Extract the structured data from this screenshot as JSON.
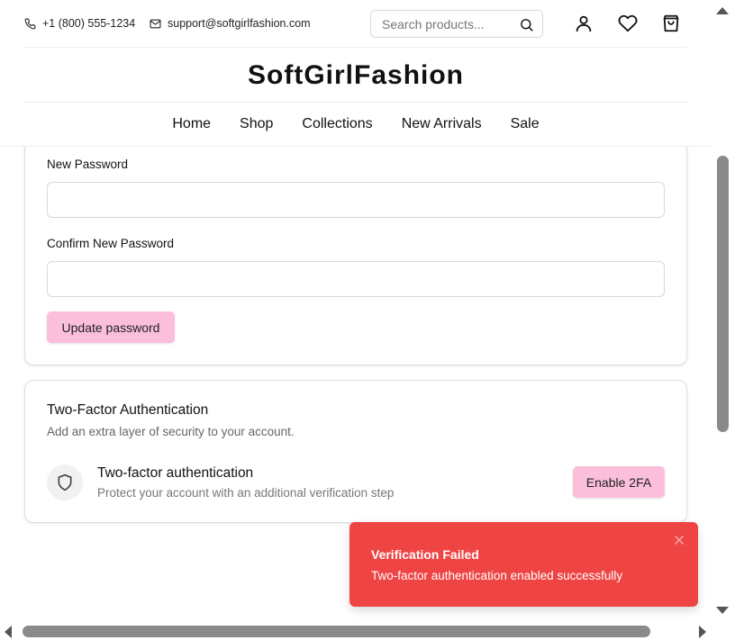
{
  "topbar": {
    "phone": "+1 (800) 555-1234",
    "email": "support@softgirlfashion.com",
    "search_placeholder": "Search products..."
  },
  "brand": "SoftGirlFashion",
  "nav": [
    "Home",
    "Shop",
    "Collections",
    "New Arrivals",
    "Sale"
  ],
  "password_card": {
    "new_password_label": "New Password",
    "new_password_value": "",
    "confirm_password_label": "Confirm New Password",
    "confirm_password_value": "",
    "update_button": "Update password"
  },
  "two_factor": {
    "title": "Two-Factor Authentication",
    "subtitle": "Add an extra layer of security to your account.",
    "row_title": "Two-factor authentication",
    "row_subtitle": "Protect your account with an additional verification step",
    "enable_button": "Enable 2FA"
  },
  "toast": {
    "title": "Verification Failed",
    "message": "Two-factor authentication enabled successfully"
  },
  "colors": {
    "accent_pink": "#fbbfdc",
    "toast_red": "#ef4444"
  }
}
